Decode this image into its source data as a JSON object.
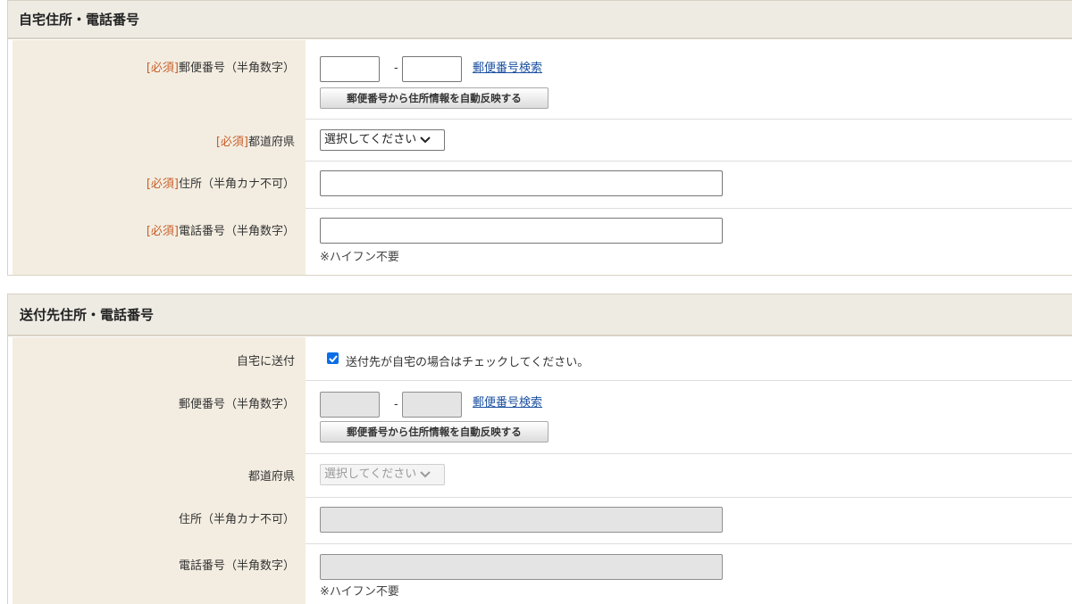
{
  "home": {
    "title": "自宅住所・電話番号",
    "required_tag": "[必須]",
    "postal_label": "郵便番号（半角数字）",
    "postal_dash": "-",
    "postal_search_link": "郵便番号検索",
    "autofill_button": "郵便番号から住所情報を自動反映する",
    "prefecture_label": "都道府県",
    "prefecture_select": "選択してください",
    "address_label": "住所（半角カナ不可）",
    "phone_label": "電話番号（半角数字）",
    "phone_note": "※ハイフン不要"
  },
  "shipping": {
    "title": "送付先住所・電話番号",
    "same_as_home_label": "自宅に送付",
    "same_as_home_checkbox_text": "送付先が自宅の場合はチェックしてください。",
    "same_as_home_checked": true,
    "postal_label": "郵便番号（半角数字）",
    "postal_dash": "-",
    "postal_search_link": "郵便番号検索",
    "autofill_button": "郵便番号から住所情報を自動反映する",
    "prefecture_label": "都道府県",
    "prefecture_select": "選択してください",
    "address_label": "住所（半角カナ不可）",
    "phone_label": "電話番号（半角数字）",
    "phone_note": "※ハイフン不要"
  },
  "colors": {
    "label_bg": "#f3ede1",
    "header_bg": "#eeebe3",
    "required": "#c8602a",
    "link": "#1a4fa0",
    "checkbox": "#0a6ee6"
  },
  "icons": {
    "select_arrow": "chevron-down-icon",
    "checkbox": "check-icon"
  }
}
